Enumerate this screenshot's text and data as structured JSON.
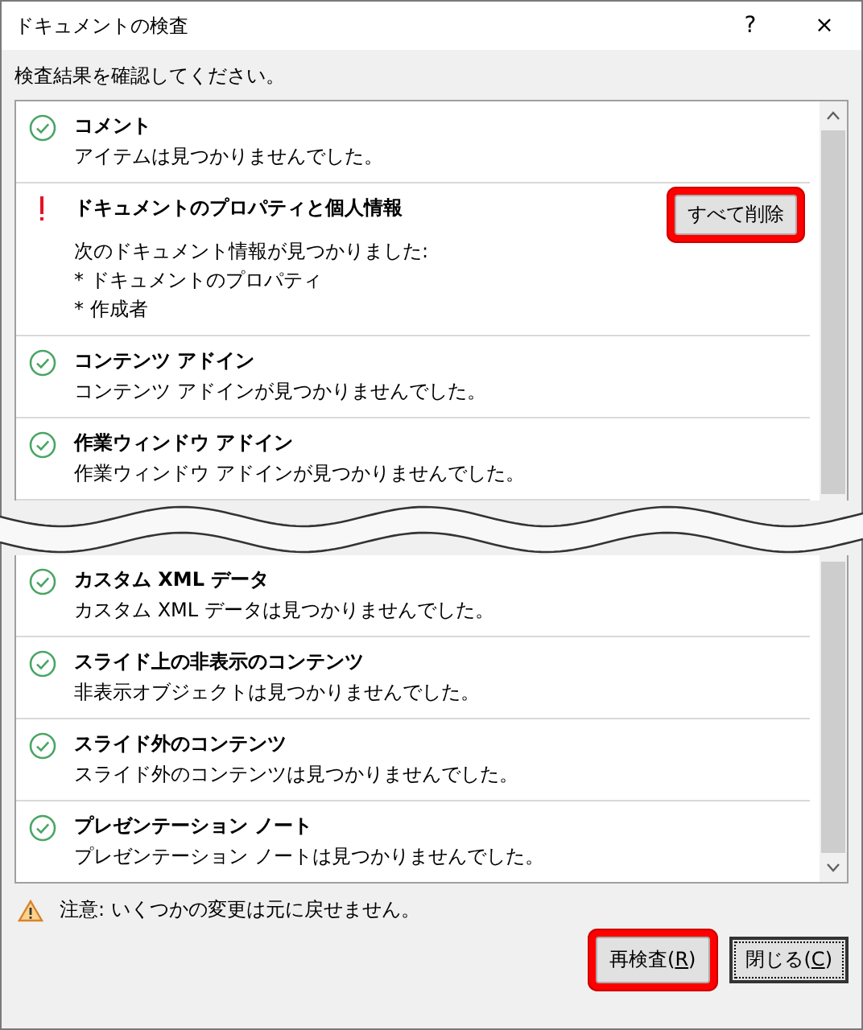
{
  "window": {
    "title": "ドキュメントの検査",
    "help": "?",
    "close": "×"
  },
  "instruction": "検査結果を確認してください。",
  "results": [
    {
      "kind": "ok",
      "title": "コメント",
      "lines": [
        "アイテムは見つかりませんでした。"
      ]
    },
    {
      "kind": "warning",
      "title": "ドキュメントのプロパティと個人情報",
      "lines": [
        "次のドキュメント情報が見つかりました:",
        "* ドキュメントのプロパティ",
        "* 作成者"
      ],
      "button": {
        "label": "すべて削除",
        "highlighted": true
      }
    },
    {
      "kind": "ok",
      "title": "コンテンツ アドイン",
      "lines": [
        "コンテンツ アドインが見つかりませんでした。"
      ]
    },
    {
      "kind": "ok",
      "title": "作業ウィンドウ アドイン",
      "lines": [
        "作業ウィンドウ アドインが見つかりませんでした。"
      ]
    },
    {
      "kind": "ok",
      "title": "カスタム XML データ",
      "lines": [
        "カスタム XML データは見つかりませんでした。"
      ],
      "break_before": true
    },
    {
      "kind": "ok",
      "title": "スライド上の非表示のコンテンツ",
      "lines": [
        "非表示オブジェクトは見つかりませんでした。"
      ]
    },
    {
      "kind": "ok",
      "title": "スライド外のコンテンツ",
      "lines": [
        "スライド外のコンテンツは見つかりませんでした。"
      ]
    },
    {
      "kind": "ok",
      "title": "プレゼンテーション ノート",
      "lines": [
        "プレゼンテーション ノートは見つかりませんでした。"
      ]
    }
  ],
  "note": "注意: いくつかの変更は元に戻せません。",
  "buttons": [
    {
      "text_before": "再検査(",
      "access_key": "R",
      "text_after": ")",
      "highlighted": true,
      "focused": false
    },
    {
      "text_before": "閉じる(",
      "access_key": "C",
      "text_after": ")",
      "highlighted": false,
      "focused": true
    }
  ]
}
